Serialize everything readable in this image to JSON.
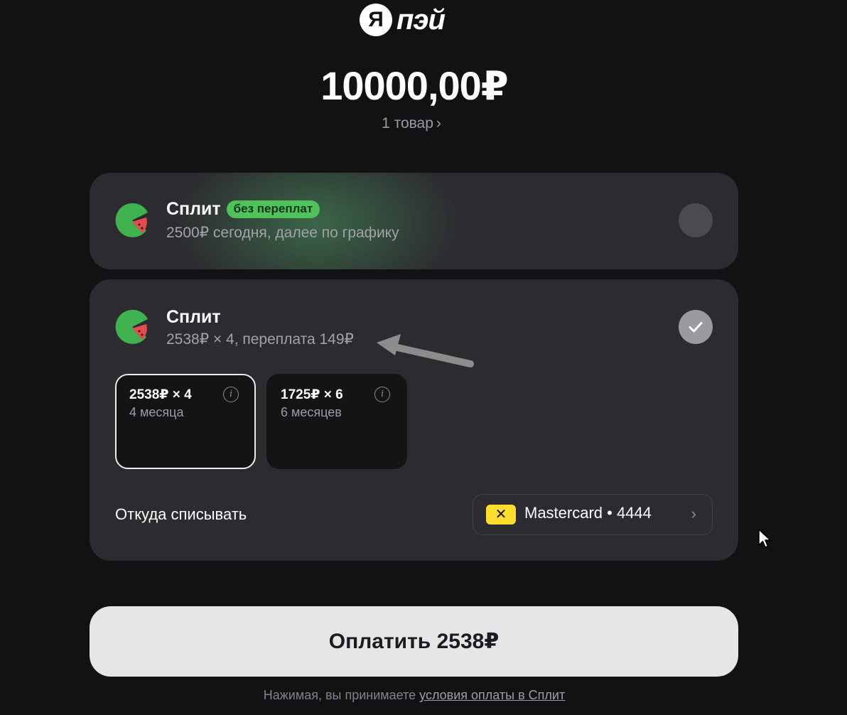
{
  "header": {
    "logo_letter": "Я",
    "logo_text": "пэй",
    "amount": "10000,00₽",
    "items_link": "1 товар",
    "items_chevron": "›"
  },
  "options": [
    {
      "title": "Сплит",
      "badge": "без переплат",
      "subtitle": "2500₽ сегодня, далее по графику",
      "selected": false
    },
    {
      "title": "Сплит",
      "subtitle": "2538₽ × 4, переплата 149₽",
      "selected": true,
      "plans": [
        {
          "price": "2538₽ × 4",
          "term": "4 месяца",
          "selected": true
        },
        {
          "price": "1725₽ × 6",
          "term": "6 месяцев",
          "selected": false
        }
      ],
      "source_label": "Откуда списывать",
      "source_card": {
        "badge_glyph": "✕",
        "text": "Mastercard • 4444",
        "chevron": "›"
      }
    }
  ],
  "pay_button_label": "Оплатить 2538₽",
  "terms": {
    "prefix": "Нажимая, вы принимаете",
    "link": "условия оплаты в Сплит"
  },
  "colors": {
    "background": "#121214",
    "card": "#2c2c30",
    "badge_green": "#4fc25a",
    "card_badge_yellow": "#ffdd2d",
    "pay_button": "#e6e6e9"
  },
  "icons": {
    "split": "split-watermelon-icon",
    "check": "check-icon",
    "info": "info-icon",
    "annotation": "arrow-annotation-icon",
    "cursor": "mouse-cursor-icon"
  }
}
